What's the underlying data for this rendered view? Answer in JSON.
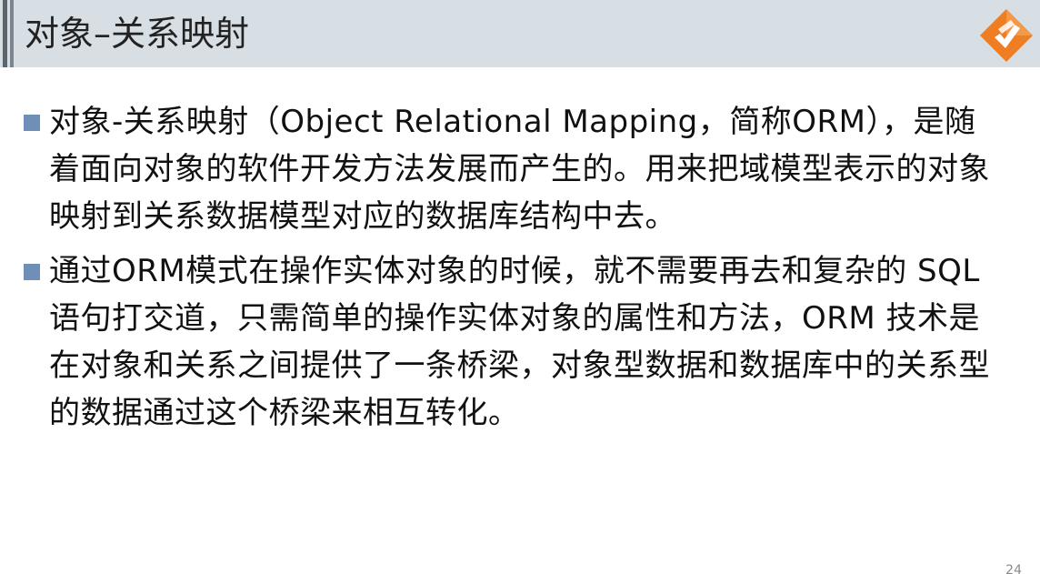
{
  "slide": {
    "title": "对象–关系映射",
    "page_number": "24",
    "colors": {
      "title_bar_bg": "#d7dee4",
      "bullet": "#6f8fb8",
      "logo_orange": "#ef7d22"
    },
    "logo_icon": "orange-diamond-logo-icon",
    "bullets": [
      {
        "text": "对象-关系映射（Object Relational Mapping，简称ORM），是随着面向对象的软件开发方法发展而产生的。用来把域模型表示的对象映射到关系数据模型对应的数据库结构中去。"
      },
      {
        "text": "通过ORM模式在操作实体对象的时候，就不需要再去和复杂的 SQL语句打交道，只需简单的操作实体对象的属性和方法，ORM 技术是在对象和关系之间提供了一条桥梁，对象型数据和数据库中的关系型的数据通过这个桥梁来相互转化。"
      }
    ]
  }
}
